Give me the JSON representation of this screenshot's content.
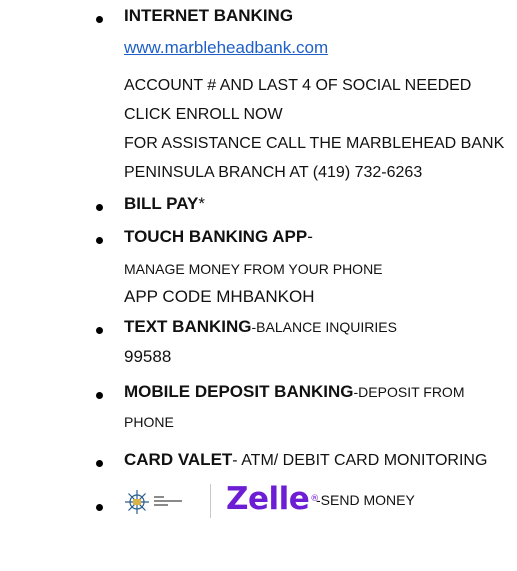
{
  "items": [
    {
      "title": "INTERNET BANKING",
      "link": "www.marbleheadbank.com",
      "lines": [
        "ACCOUNT # AND LAST 4 OF SOCIAL NEEDED",
        "CLICK ENROLL NOW",
        "FOR ASSISTANCE CALL THE MARBLEHEAD BANK",
        "PENINSULA BRANCH AT (419) 732-6263"
      ]
    },
    {
      "title": "BILL PAY",
      "suffix": "*"
    },
    {
      "title": "TOUCH BANKING APP",
      "suffix": "-",
      "lines": [
        "MANAGE MONEY FROM YOUR PHONE",
        "APP CODE MHBANKOH"
      ]
    },
    {
      "title": "TEXT BANKING",
      "suffix": "-BALANCE INQUIRIES",
      "lines": [
        "99588"
      ]
    },
    {
      "title": "MOBILE DEPOSIT BANKING",
      "suffix": "-DEPOSIT FROM",
      "lines": [
        "PHONE"
      ]
    },
    {
      "title": "CARD VALET",
      "suffix": "- ATM/ DEBIT CARD MONITORING"
    },
    {
      "logos": {
        "bank_logo_text": "THE MARBLEHEAD BANK",
        "zelle_text": "Zelle",
        "zelle_mark": "®",
        "zelle_color": "#6d1ed4"
      },
      "suffix": "-SEND MONEY"
    }
  ],
  "colors": {
    "link": "#1f5fc7",
    "text": "#111111"
  }
}
